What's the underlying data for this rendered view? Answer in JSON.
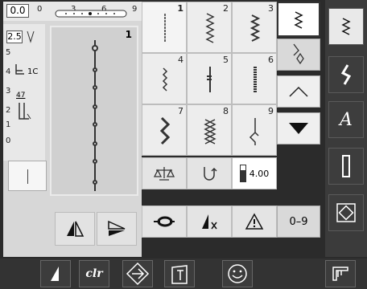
{
  "ruler": {
    "top_value": "0.0",
    "top_ticks": [
      "0",
      "3",
      "6",
      "9"
    ],
    "left_value": "2.5",
    "left_ticks": [
      "5",
      "4",
      "3",
      "2",
      "1",
      "0"
    ],
    "presser_label": "1C",
    "tension_label": "47"
  },
  "preview": {
    "pattern_number": "1"
  },
  "grid": {
    "stitch_numbers": [
      "1",
      "2",
      "3",
      "4",
      "5",
      "6",
      "7",
      "8",
      "9"
    ],
    "width_value": "4.00",
    "numbers_button": "0–9"
  },
  "bottom": {
    "clear_label": "clr"
  }
}
